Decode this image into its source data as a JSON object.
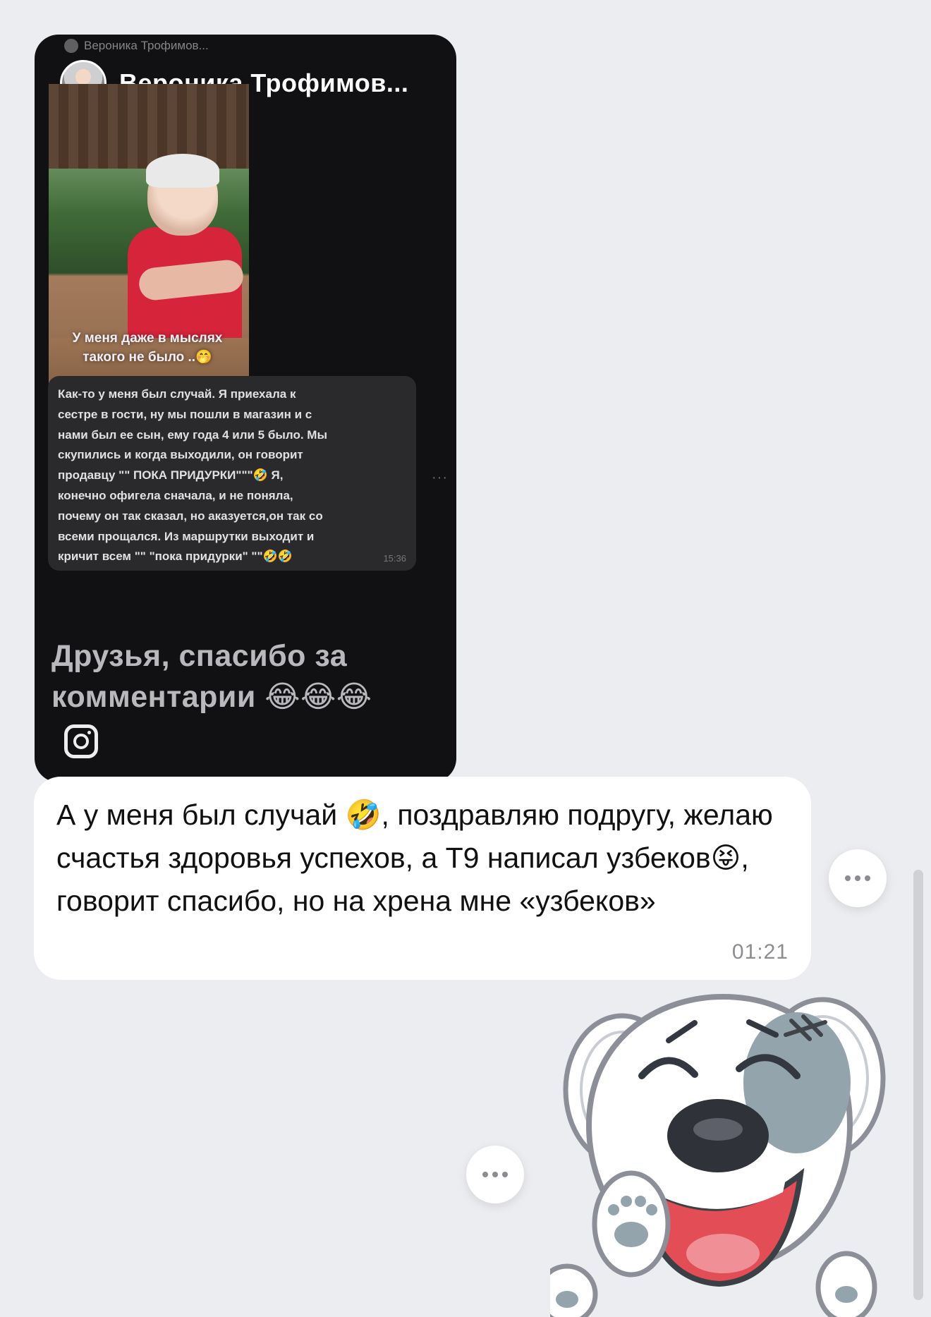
{
  "story": {
    "topline_author": "Вероника Трофимов...",
    "author": "Вероника Трофимов...",
    "photo_caption": "У меня даже в мыслях такого не было ..🤭",
    "comment_text": "Как-то у меня был случай. Я приехала к\nсестре в гости, ну мы пошли в магазин и с\nнами был ее сын, ему года 4 или 5 было. Мы\nскупились и когда выходили, он говорит\nпродавцу \"\" ПОКА ПРИДУРКИ\"\"\"🤣 Я,\nконечно офигела сначала, и не поняла,\nпочему он так сказал, но аказуется,он так со\nвсеми прощался. Из маршрутки выходит и\nкричит всем \"\" \"пока придурки\" \"\"🤣🤣",
    "comment_time": "15:36",
    "comment_more": "···",
    "bottom_title": "Друзья, спасибо за комментарии 😂😂😂"
  },
  "message": {
    "text": "А у меня был случай 🤣, поздравляю подругу, желаю счастья здоровья успехов, а Т9 написал узбеков😝, говорит спасибо, но на хрена мне «узбеков»",
    "time": "01:21"
  },
  "icons": {
    "message_more": "more-dots-icon",
    "sticker_more": "more-dots-icon",
    "story_source": "instagram-icon"
  },
  "colors": {
    "background": "#ecedf0",
    "bubble": "#ffffff",
    "story_background": "#111113",
    "time_text": "#8b8d92"
  }
}
